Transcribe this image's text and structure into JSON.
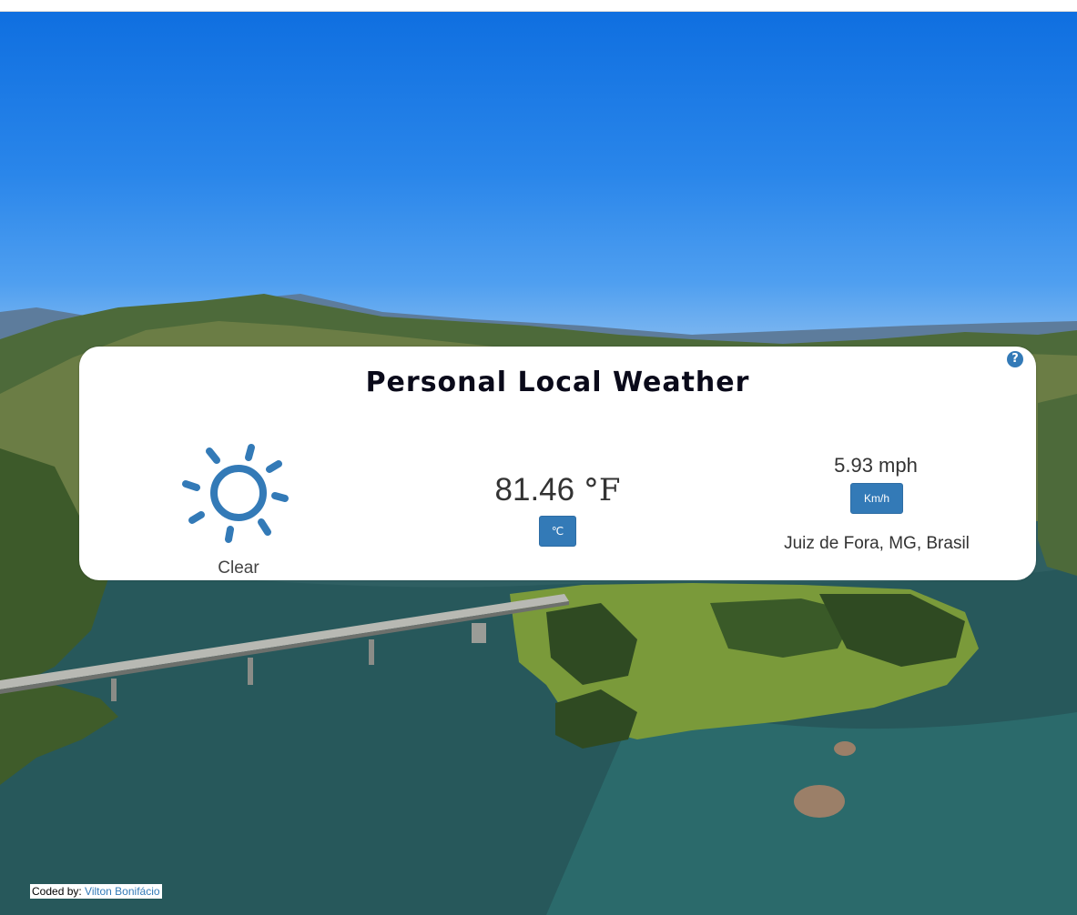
{
  "app": {
    "title": "Personal Local Weather",
    "help_icon": "question-circle-icon"
  },
  "weather": {
    "icon": "sun-icon",
    "condition": "Clear",
    "temperature": "81.46",
    "temperature_unit": "°F",
    "temperature_toggle_label": "℃",
    "wind_speed": "5.93 mph",
    "speed_toggle_label": "Km/h",
    "location": "Juiz de Fora, MG, Brasil"
  },
  "footer": {
    "credit_prefix": "Coded by: ",
    "credit_author": "Vilton Bonifácio"
  },
  "colors": {
    "accent": "#337ab7",
    "card_background": "#ffffff",
    "title": "#0a0a1a"
  }
}
